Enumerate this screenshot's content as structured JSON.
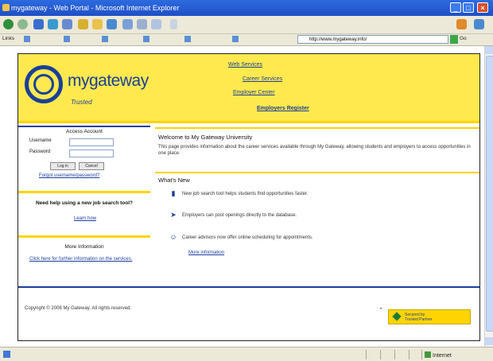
{
  "window": {
    "title": "mygateway - Web Portal - Microsoft Internet Explorer"
  },
  "links_bar": {
    "items": [
      "Links",
      "",
      "",
      "",
      "",
      "",
      ""
    ],
    "address": "http://www.mygateway.info/",
    "go_label": "Go"
  },
  "status_bar": {
    "zone": "Internet"
  },
  "banner": {
    "logo_word": "mygateway",
    "logo_tagline": "Trusted",
    "nav": [
      "Web Services",
      "Career Services",
      "Employer Center",
      "Employers Register"
    ]
  },
  "login": {
    "title": "Access Account",
    "username_label": "Username",
    "password_label": "Password",
    "login_button": "Log in",
    "cancel_button": "Cancel",
    "forgot_link": "Forgot username/password?"
  },
  "side_panel_2": {
    "text": "Need help using a new job search tool?",
    "link": "Learn how"
  },
  "side_panel_3": {
    "title": "More Information",
    "link_text": "Click here for further information on the services."
  },
  "main": {
    "welcome_heading": "Welcome to My Gateway University",
    "intro": "This page provides information about the career services available through My Gateway, allowing students and employers to access opportunities in one place.",
    "whats_heading": "What's New",
    "features": [
      "New job search tool helps students find opportunities faster.",
      "Employers can post openings directly to the database.",
      "Career advisors now offer online scheduling for appointments.",
      "More information"
    ]
  },
  "footer": {
    "copyright": "Copyright © 2006 My Gateway. All rights reserved.",
    "badge_line1": "Secured by",
    "badge_line2": "Trusted Partner"
  }
}
